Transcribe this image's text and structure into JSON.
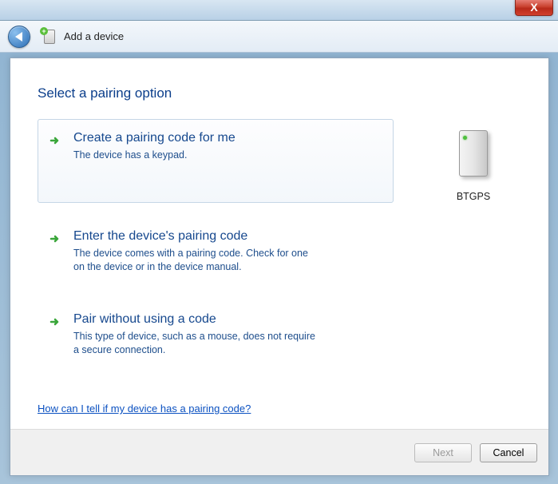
{
  "chrome": {
    "close": "X"
  },
  "nav": {
    "title": "Add a device"
  },
  "page": {
    "title": "Select a pairing option"
  },
  "options": [
    {
      "title": "Create a pairing code for me",
      "desc": "The device has a keypad."
    },
    {
      "title": "Enter the device's pairing code",
      "desc": "The device comes with a pairing code. Check for one on the device or in the device manual."
    },
    {
      "title": "Pair without using a code",
      "desc": "This type of device, such as a mouse, does not require a secure connection."
    }
  ],
  "device": {
    "label": "BTGPS"
  },
  "help_link": "How can I tell if my device has a pairing code?",
  "buttons": {
    "next": "Next",
    "cancel": "Cancel"
  }
}
